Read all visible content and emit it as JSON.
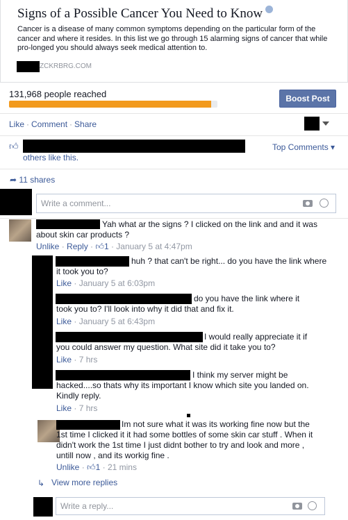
{
  "link_card": {
    "title": "Signs of a Possible Cancer You Need to Know",
    "description": "Cancer is a disease of many common symptoms depending on the particular form of the cancer and where it resides. In this list we go through 15 alarming signs of cancer that while pro-longed you should always seek medical attention to.",
    "domain": "ZCKRBRG.COM"
  },
  "boost": {
    "reached_text": "131,968 people reached",
    "progress": 0.97,
    "button_label": "Boost Post"
  },
  "actions": {
    "like": "Like",
    "comment": "Comment",
    "share": "Share",
    "dot": "·"
  },
  "likes": {
    "others_text": "others like this.",
    "top_comments": "Top Comments"
  },
  "shares_text": "11 shares",
  "composer": {
    "placeholder": "Write a comment..."
  },
  "comments": [
    {
      "text": "Yah what ar the signs ? I clicked on the link and and it was about skin car products ?",
      "unlike": "Unlike",
      "reply": "Reply",
      "likes": "1",
      "time": "January 5 at 4:47pm"
    }
  ],
  "replies": [
    {
      "text": "huh ? that can't be right... do you have the link where it took you to?",
      "like": "Like",
      "time": "January 5 at 6:03pm"
    },
    {
      "text": "do you have the link where it took you to? I'll look into why it did that and fix it.",
      "like": "Like",
      "time": "January 5 at 6:43pm"
    },
    {
      "text": "I would really appreciate it if you could answer my question. What site did it take you to?",
      "like": "Like",
      "time": "7 hrs"
    },
    {
      "text": "I think my server might be hacked....so thats why its important I know which site you landed on. Kindly reply.",
      "like": "Like",
      "time": "7 hrs"
    },
    {
      "text": "Im not sure what it was its working fine now but the 1st time I clicked it it had some bottles of some skin car stuff . When it didn't work the 1st time I just didnt bother to try and look and more , untill now , and its workig fine .",
      "unlike": "Unlike",
      "likes": "1",
      "time": "21 mins"
    }
  ],
  "view_more": "View more replies",
  "reply_box": {
    "placeholder": "Write a reply..."
  }
}
